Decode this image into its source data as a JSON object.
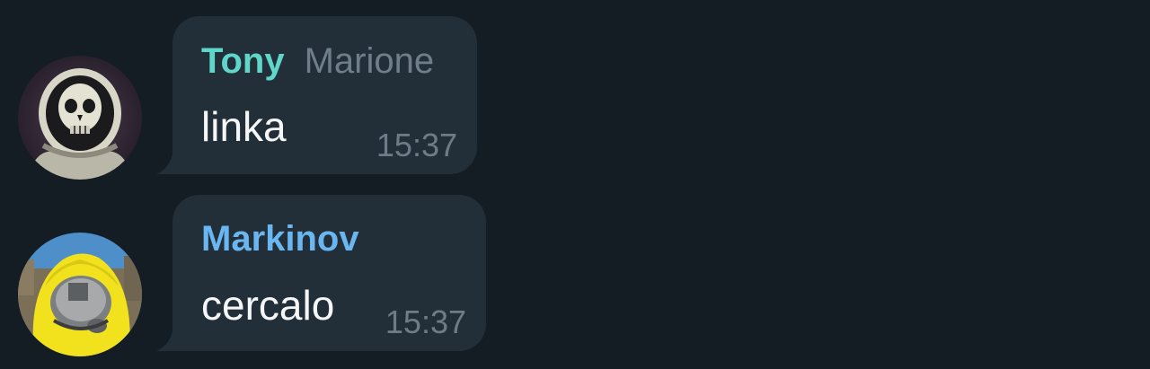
{
  "messages": [
    {
      "sender": "Tony",
      "via": "Marione",
      "text": "linka",
      "time": "15:37",
      "sender_color": "#5fd6c9",
      "avatar_icon": "astronaut-skull-avatar"
    },
    {
      "sender": "Markinov",
      "text": "cercalo",
      "time": "15:37",
      "sender_color": "#6ab6f0",
      "avatar_icon": "yellow-hazmat-avatar"
    }
  ],
  "colors": {
    "background": "#141d24",
    "bubble": "#222f38",
    "time": "#6d7c86"
  }
}
